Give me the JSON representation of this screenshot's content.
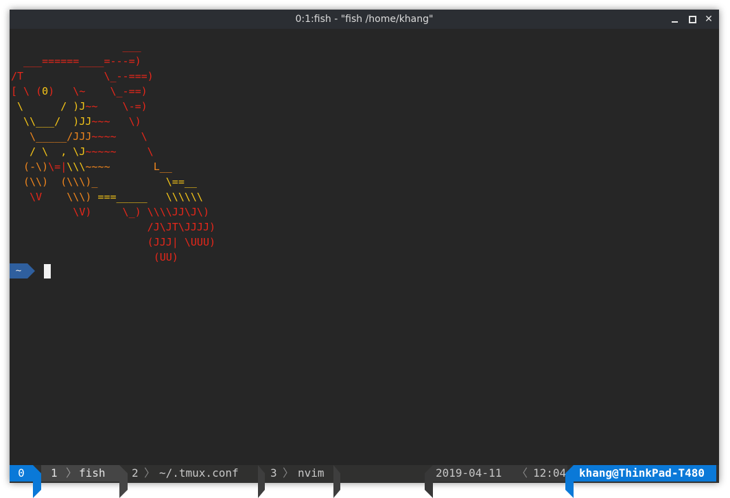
{
  "window": {
    "title": "0:1:fish - \"fish  /home/khang\"",
    "buttons": {
      "minimize": "minimize-icon",
      "maximize": "maximize-icon",
      "close": "close-icon"
    }
  },
  "art": {
    "lines": [
      [
        [
          "                  ___",
          "r"
        ]
      ],
      [
        [
          "  ___======____=---=)",
          "r"
        ]
      ],
      [
        [
          "/T             \\_--===)",
          "r"
        ]
      ],
      [
        [
          "[ \\ (",
          "r"
        ],
        [
          "0",
          "y"
        ],
        [
          ")   \\~    \\_-==)",
          "r"
        ]
      ],
      [
        [
          " \\      / )J",
          "y"
        ],
        [
          "~~    \\-=)",
          "r"
        ]
      ],
      [
        [
          "  \\\\___/  )JJ",
          "y"
        ],
        [
          "~~~   \\)",
          "r"
        ]
      ],
      [
        [
          "   \\_____/JJJ",
          "o"
        ],
        [
          "~~~~    \\",
          "r"
        ]
      ],
      [
        [
          "   / \\  , \\J",
          "y"
        ],
        [
          "~~~~~     \\",
          "r"
        ]
      ],
      [
        [
          "  (-\\)",
          "o"
        ],
        [
          "\\=|",
          "r"
        ],
        [
          "\\\\\\",
          "y"
        ],
        [
          "~~~~       L__",
          "o"
        ]
      ],
      [
        [
          "  (\\\\)  (\\\\\\)_",
          "o"
        ],
        [
          "           \\==__",
          "y"
        ]
      ],
      [
        [
          "   \\V    ",
          "r"
        ],
        [
          "\\\\\\)",
          "o"
        ],
        [
          " ===_____   \\\\\\\\\\\\",
          "y"
        ]
      ],
      [
        [
          "          \\V)     \\_) \\\\\\\\JJ\\J\\)",
          "r"
        ]
      ],
      [
        [
          "                      /J\\JT\\JJJJ)",
          "r"
        ]
      ],
      [
        [
          "                      (JJJ| \\UUU)",
          "r"
        ]
      ],
      [
        [
          "                       (UU)",
          "r"
        ]
      ]
    ]
  },
  "prompt": {
    "cwd": "~"
  },
  "statusbar": {
    "session": "0",
    "windows": [
      {
        "index": "1",
        "name": "fish",
        "active": true
      },
      {
        "index": "2",
        "name": "~/.tmux.conf",
        "active": false
      },
      {
        "index": "3",
        "name": "nvim",
        "active": false
      }
    ],
    "date": "2019-04-11",
    "time": "12:04",
    "host": "khang@ThinkPad-T480"
  },
  "colors": {
    "accent_blue": "#0a79d8",
    "prompt_blue": "#2f5f9e",
    "art_red": "#e8271a",
    "art_orange": "#f0861d",
    "art_yellow": "#f5c518",
    "terminal_bg": "#262626"
  }
}
